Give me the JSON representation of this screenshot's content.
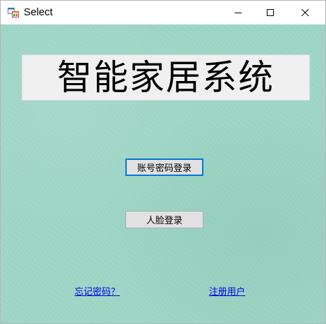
{
  "window": {
    "title": "Select",
    "controls": {
      "minimize_icon": "minimize-icon",
      "maximize_icon": "maximize-icon",
      "close_icon": "close-icon"
    }
  },
  "banner": {
    "text": "智能家居系统"
  },
  "buttons": {
    "account_login": "账号密码登录",
    "face_login": "人脸登录"
  },
  "links": {
    "forgot_password": "忘记密码？",
    "register_user": "注册用户"
  },
  "colors": {
    "client_background": "#9ed6c6",
    "focus_border": "#0078d7",
    "link": "#0000ee"
  }
}
